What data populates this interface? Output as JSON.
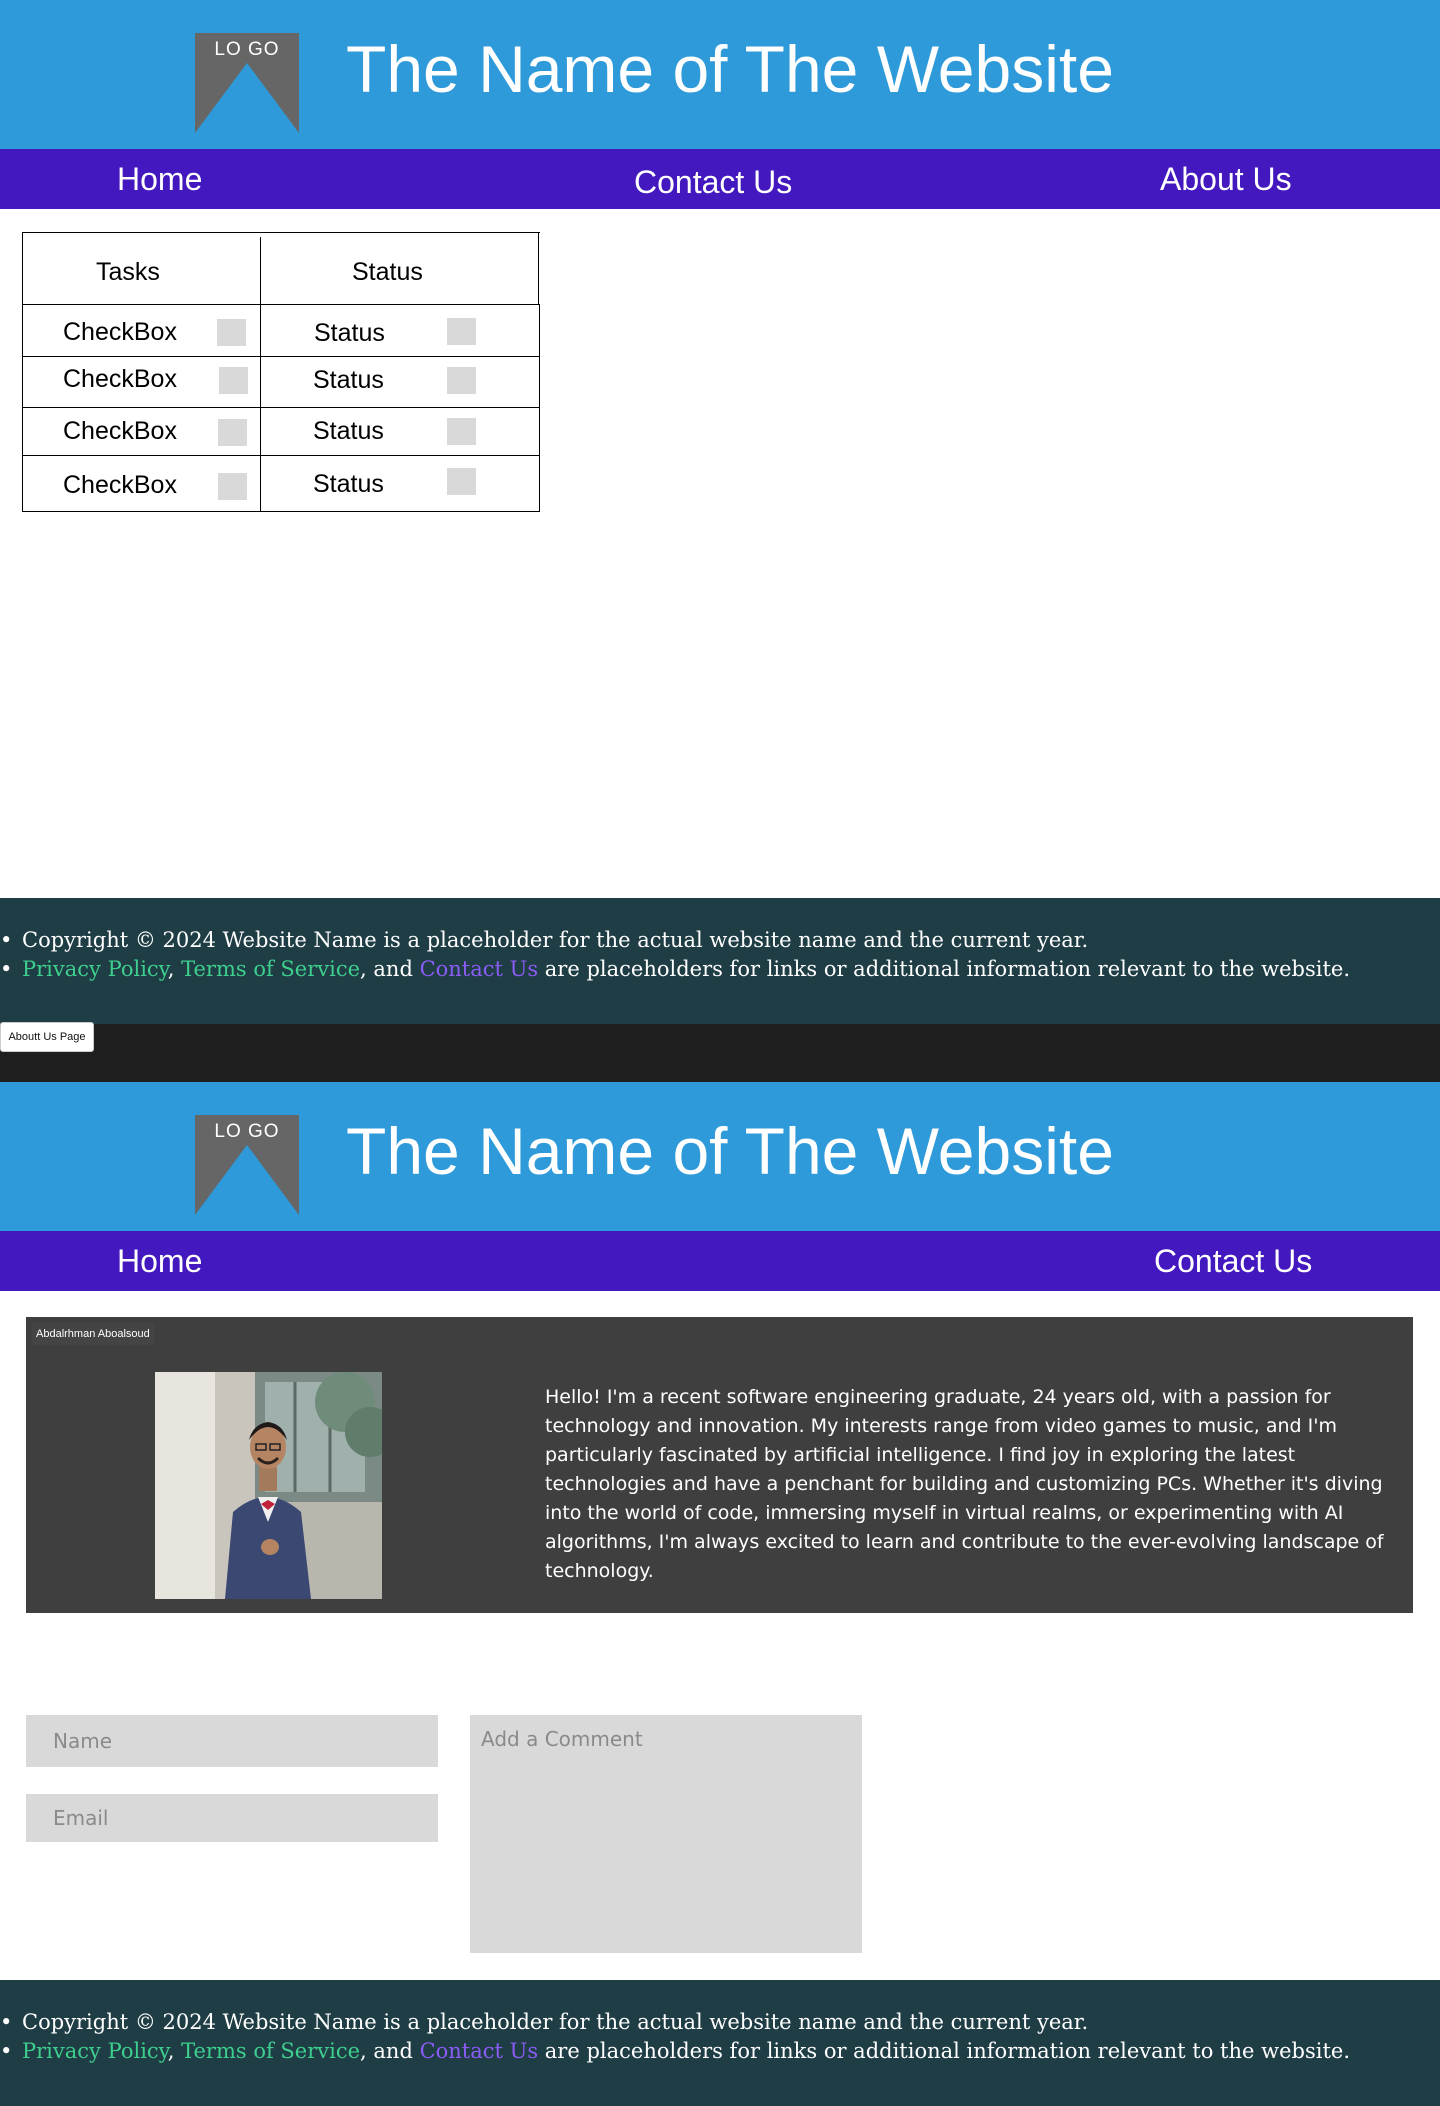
{
  "header": {
    "logo_text": "LO GO",
    "site_title": "The Name of The Website"
  },
  "page1": {
    "nav": {
      "home": "Home",
      "contact": "Contact Us",
      "about": "About Us"
    },
    "table": {
      "headers": [
        "Tasks",
        "Status"
      ],
      "rows": [
        {
          "task": "CheckBox",
          "status": "Status"
        },
        {
          "task": "CheckBox",
          "status": "Status"
        },
        {
          "task": "CheckBox",
          "status": "Status"
        },
        {
          "task": "CheckBox",
          "status": "Status"
        }
      ]
    }
  },
  "frame_label": "Aboutt Us Page",
  "page2": {
    "nav": {
      "home": "Home",
      "contact": "Contact Us"
    },
    "profile": {
      "name": "Abdalrhman Aboalsoud",
      "bio": "Hello! I'm a recent software engineering graduate, 24 years old, with a passion for technology and innovation. My interests range from video games to music, and I'm particularly fascinated by artificial intelligence. I find joy in exploring the latest technologies and have a penchant for building and customizing PCs. Whether it's diving into the world of code, immersing myself in virtual realms, or experimenting with AI algorithms, I'm always excited to learn and contribute to the ever-evolving landscape of technology."
    },
    "form": {
      "name_placeholder": "Name",
      "email_placeholder": "Email",
      "comment_placeholder": "Add a Comment"
    }
  },
  "footer": {
    "line1": "Copyright © 2024 Website Name is a placeholder for the actual website name and the current year.",
    "privacy": "Privacy Policy",
    "sep1": ", ",
    "terms": "Terms of Service",
    "sep2": ", and ",
    "contact": "Contact Us",
    "line2_tail": " are placeholders for links or additional information relevant to the website."
  },
  "colors": {
    "header_bg": "#2e9ad9",
    "nav_bg": "#4318bf",
    "footer_bg": "#1f3d45",
    "profile_bg": "#3f3f3f",
    "link_green": "#3ecf8e",
    "link_purple": "#8b5cf6"
  }
}
